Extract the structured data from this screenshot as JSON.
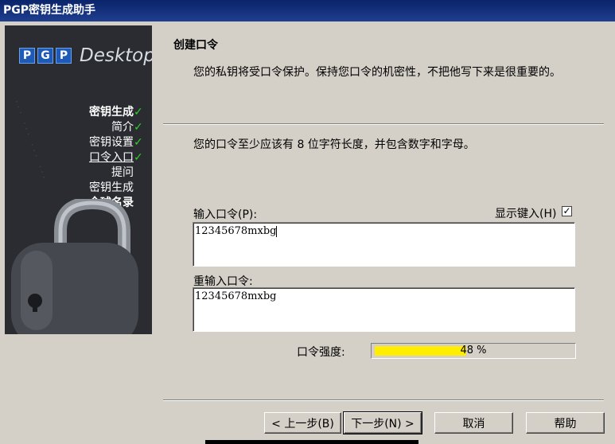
{
  "window": {
    "title": "PGP密钥生成助手"
  },
  "sidebar": {
    "logo_letters": [
      "P",
      "G",
      "P"
    ],
    "logo_text": "Desktop",
    "steps": [
      {
        "label": "密钥生成",
        "checked": true,
        "bold": true,
        "underline": false
      },
      {
        "label": "简介",
        "checked": true,
        "bold": false,
        "underline": false
      },
      {
        "label": "密钥设置",
        "checked": true,
        "bold": false,
        "underline": false
      },
      {
        "label": "口令入口",
        "checked": true,
        "bold": false,
        "underline": true
      },
      {
        "label": "提问",
        "checked": false,
        "bold": false,
        "underline": false
      },
      {
        "label": "密钥生成",
        "checked": false,
        "bold": false,
        "underline": false
      },
      {
        "label": "全球名录",
        "checked": false,
        "bold": true,
        "underline": false
      }
    ]
  },
  "page": {
    "heading": "创建口令",
    "description": "您的私钥将受口令保护。保持您口令的机密性，不把他写下来是很重要的。",
    "requirement": "您的口令至少应该有 8 位字符长度，并包含数字和字母。"
  },
  "form": {
    "passphrase_label": "输入口令(P):",
    "passphrase_value": "12345678mxbg",
    "show_typing_label": "显示键入(H)",
    "show_typing_checked": true,
    "confirm_label": "重输入口令:",
    "confirm_value": "12345678mxbg",
    "strength_label": "口令强度:",
    "strength_percent": 48,
    "strength_text": "48 %"
  },
  "buttons": {
    "back": "< 上一步(B)",
    "next": "下一步(N) >",
    "cancel": "取消",
    "help": "帮助"
  },
  "colors": {
    "titlebar": "#0a246a",
    "strength_fill": "#ffee00",
    "checkmark": "#29d229",
    "logo_blue": "#1e5bb7"
  }
}
